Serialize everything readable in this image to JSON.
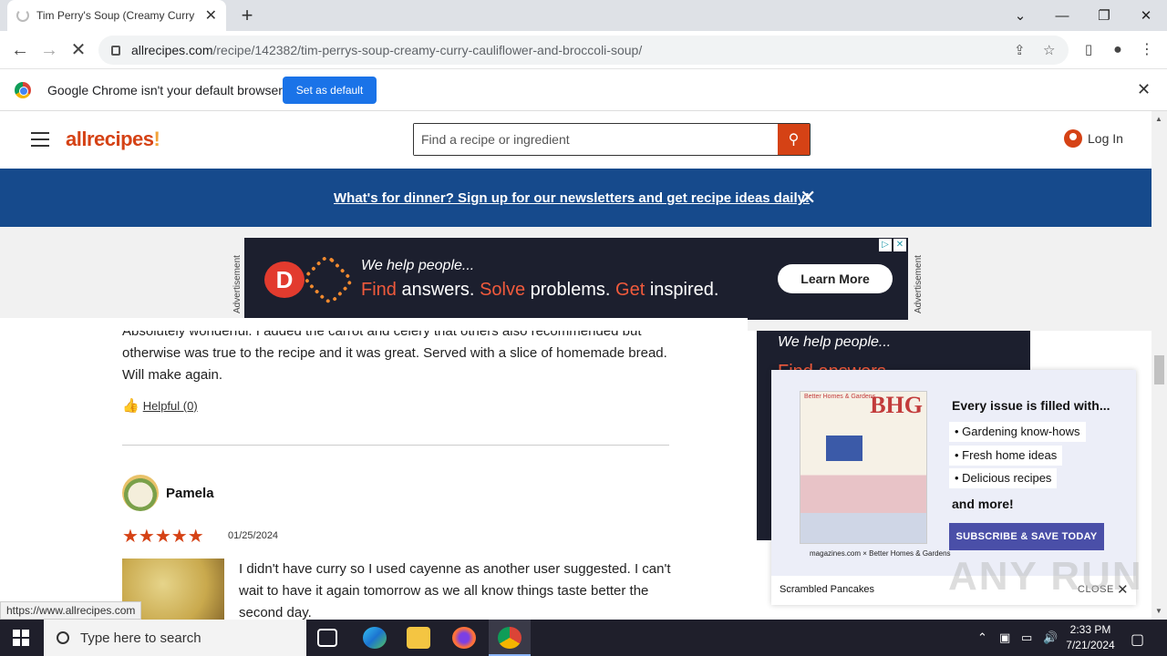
{
  "browser": {
    "tab_title": "Tim Perry's Soup (Creamy Curry",
    "url_host": "allrecipes.com",
    "url_path": "/recipe/142382/tim-perrys-soup-creamy-curry-cauliflower-and-broccoli-soup/",
    "infobar_text": "Google Chrome isn't your default browser",
    "set_default_label": "Set as default",
    "status_url": "https://www.allrecipes.com"
  },
  "site": {
    "logo": "allrecipes",
    "search_placeholder": "Find a recipe or ingredient",
    "login_label": "Log In",
    "newsletter_text": "What's for dinner? Sign up for our newsletters and get recipe ideas daily!"
  },
  "ad_top": {
    "label": "Advertisement",
    "line1": "We help people...",
    "line2_find": "Find",
    "line2_answers": " answers. ",
    "line2_solve": "Solve",
    "line2_problems": " problems. ",
    "line2_get": "Get",
    "line2_inspired": " inspired.",
    "cta": "Learn More"
  },
  "review_prev": {
    "text_partial": "Absolutely wonderful. I added the carrot and celery that others also recommended but otherwise was true to the recipe and it was great. Served with a slice of homemade bread. Will make again.",
    "helpful": "Helpful (0)"
  },
  "review": {
    "reviewer": "Pamela",
    "stars": "★★★★★",
    "date": "01/25/2024",
    "text": "I didn't have curry so I used cayenne as another user suggested. I can't wait to have it again tomorrow as we all know things taste better the second day."
  },
  "side_ad": {
    "line1": "We help people...",
    "line2": "Find answers."
  },
  "popup": {
    "mag_brand": "Better Homes & Gardens",
    "mag_bhg": "BHG",
    "mag_footer": "magazines.com  ×  Better Homes & Gardens",
    "title": "Every issue is filled with...",
    "bullets": [
      "Gardening know-hows",
      "Fresh home ideas",
      "Delicious recipes"
    ],
    "more": "and more!",
    "cta": "SUBSCRIBE & SAVE TODAY",
    "bottom_text": "Scrambled Pancakes",
    "close_label": "CLOSE"
  },
  "taskbar": {
    "search_placeholder": "Type here to search",
    "time": "2:33 PM",
    "date": "7/21/2024"
  },
  "watermark": "ANY RUN",
  "colors": {
    "brand": "#d54215",
    "newsletter_bg": "#164a8c",
    "chrome_blue": "#1a73e8",
    "subscribe_bg": "#4a4fa8"
  }
}
